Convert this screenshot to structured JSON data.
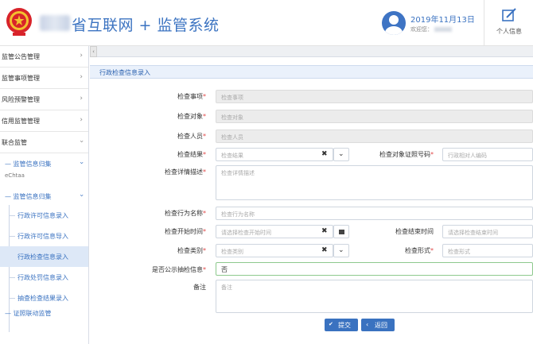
{
  "header": {
    "title": "省互联网 + 监管系统",
    "date": "2019年11月13日",
    "welcome": "欢迎您：",
    "profile_label": "个人信息",
    "brand_color": "#3b73c1"
  },
  "sidebar": {
    "items": [
      {
        "label": "监管公告管理"
      },
      {
        "label": "监管事项管理"
      },
      {
        "label": "风险预警管理"
      },
      {
        "label": "信用监管管理"
      },
      {
        "label": "联合监管"
      }
    ],
    "groups": [
      {
        "label": "— 监管信息归集"
      },
      {
        "label": "— 监管信息归集"
      }
    ],
    "leaves": [
      {
        "label": "行政许可信息录入"
      },
      {
        "label": "行政许可信息导入"
      },
      {
        "label": "行政检查信息录入"
      },
      {
        "label": "行政处罚信息录入"
      },
      {
        "label": "抽查检查结果录入"
      }
    ],
    "cut_labels": [
      "eChtaa",
      "— 证照联动监管"
    ]
  },
  "panel": {
    "title": "行政检查信息录入"
  },
  "form": {
    "inspection_item": {
      "label": "检查事项",
      "placeholder": "检查事项"
    },
    "inspection_target": {
      "label": "检查对象",
      "placeholder": "检查对象"
    },
    "inspectors": {
      "label": "检查人员",
      "placeholder": "检查人员"
    },
    "result": {
      "label": "检查结果",
      "placeholder": "检查结果"
    },
    "target_cert": {
      "label": "检查对象证照号码",
      "placeholder": "行政相对人编码"
    },
    "detail": {
      "label": "检查详情描述",
      "placeholder": "检查详情描述"
    },
    "action_name": {
      "label": "检查行为名称",
      "placeholder": "检查行为名称"
    },
    "start_time": {
      "label": "检查开始时间",
      "placeholder": "请选择检查开始时间"
    },
    "end_time": {
      "label": "检查结束时间",
      "placeholder": "请选择检查结束时间"
    },
    "category": {
      "label": "检查类别",
      "placeholder": "检查类别"
    },
    "form_type": {
      "label": "检查形式",
      "placeholder": "检查形式"
    },
    "public_disclosure": {
      "label": "是否公示抽检信息",
      "value": "否"
    },
    "remark": {
      "label": "备注",
      "placeholder": "备注"
    }
  },
  "buttons": {
    "submit": "提交",
    "back": "返回"
  },
  "icons": {
    "clear": "✖",
    "dropdown": "⌄",
    "chevron": "›",
    "collapse": "‹",
    "check": "✔"
  }
}
